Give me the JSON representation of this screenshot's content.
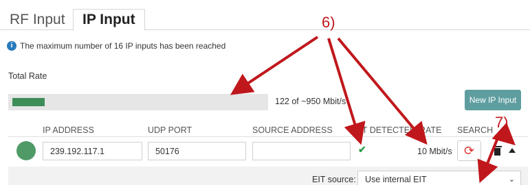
{
  "tabs": [
    {
      "label": "RF Input",
      "active": false
    },
    {
      "label": "IP Input",
      "active": true
    }
  ],
  "info": {
    "icon": "info-circle-icon",
    "message": "The maximum number of 16 IP inputs has been reached"
  },
  "total_rate": {
    "label": "Total Rate",
    "used_fraction": 0.128,
    "text": "122 of ~950 Mbit/s"
  },
  "new_input_button": "New IP Input",
  "columns": {
    "ip_address": "IP ADDRESS",
    "udp_port": "UDP PORT",
    "source_address": "SOURCE ADDRESS",
    "eit_detected": "EIT DETECTED",
    "rate": "RATE",
    "search": "SEARCH"
  },
  "rows": [
    {
      "status": "ok",
      "ip_address": "239.192.117.1",
      "udp_port": "50176",
      "source_address": "",
      "eit_detected": true,
      "rate": "10 Mbit/s"
    }
  ],
  "eit": {
    "label": "EIT source:",
    "selected": "Use internal EIT"
  },
  "annotations": {
    "six": "6)",
    "seven": "7)"
  },
  "colors": {
    "status_ok": "#4f9a66",
    "button_teal": "#5f9ea0",
    "annotation_red": "#c0171c",
    "info_blue": "#2b7bbd"
  }
}
